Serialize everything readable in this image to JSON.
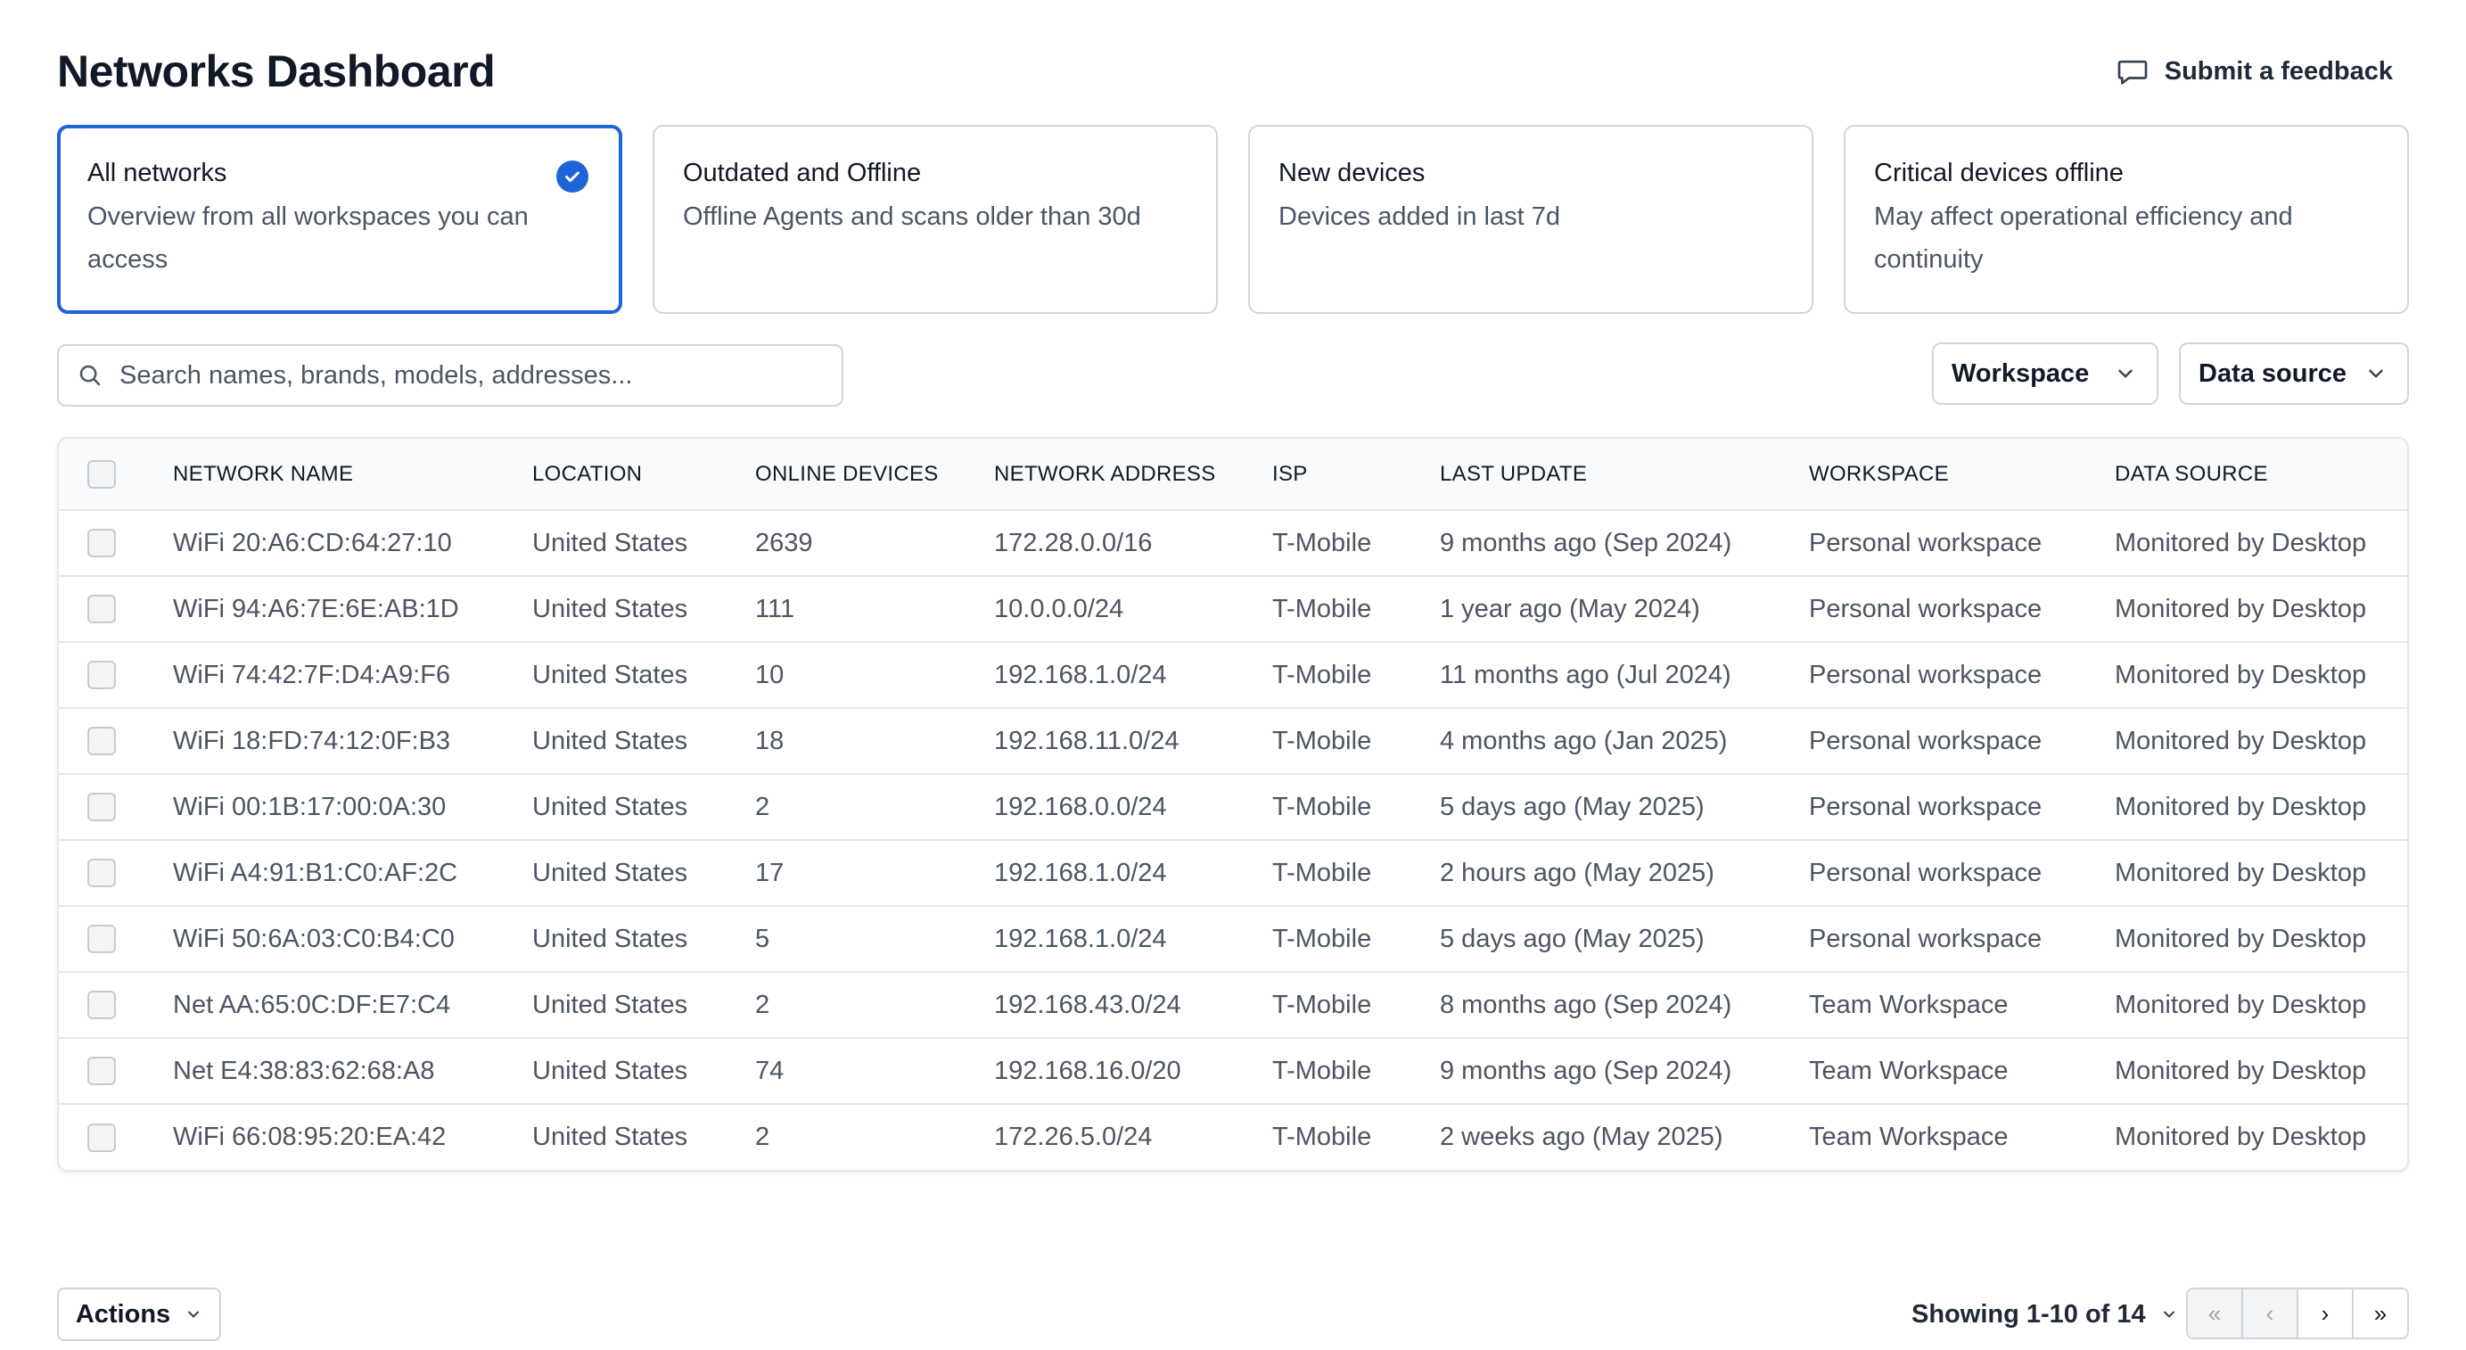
{
  "header": {
    "title": "Networks Dashboard",
    "feedback_label": "Submit a feedback"
  },
  "cards": [
    {
      "title": "All networks",
      "desc": "Overview from all workspaces you can access",
      "selected": true
    },
    {
      "title": "Outdated and Offline",
      "desc": "Offline Agents and scans older than 30d",
      "selected": false
    },
    {
      "title": "New devices",
      "desc": "Devices added in last 7d",
      "selected": false
    },
    {
      "title": "Critical devices offline",
      "desc": "May affect operational efficiency and continuity",
      "selected": false
    }
  ],
  "search": {
    "placeholder": "Search names, brands, models, addresses...",
    "value": ""
  },
  "filters": {
    "workspace_label": "Workspace",
    "data_source_label": "Data source"
  },
  "table": {
    "columns": [
      "NETWORK NAME",
      "LOCATION",
      "ONLINE DEVICES",
      "NETWORK ADDRESS",
      "ISP",
      "LAST UPDATE",
      "WORKSPACE",
      "DATA SOURCE"
    ],
    "rows": [
      [
        "WiFi 20:A6:CD:64:27:10",
        "United States",
        "2639",
        "172.28.0.0/16",
        "T-Mobile",
        "9 months ago (Sep 2024)",
        "Personal workspace",
        "Monitored by Desktop"
      ],
      [
        "WiFi 94:A6:7E:6E:AB:1D",
        "United States",
        "111",
        "10.0.0.0/24",
        "T-Mobile",
        "1 year ago (May 2024)",
        "Personal workspace",
        "Monitored by Desktop"
      ],
      [
        "WiFi 74:42:7F:D4:A9:F6",
        "United States",
        "10",
        "192.168.1.0/24",
        "T-Mobile",
        "11 months ago (Jul 2024)",
        "Personal workspace",
        "Monitored by Desktop"
      ],
      [
        "WiFi 18:FD:74:12:0F:B3",
        "United States",
        "18",
        "192.168.11.0/24",
        "T-Mobile",
        "4 months ago (Jan 2025)",
        "Personal workspace",
        "Monitored by Desktop"
      ],
      [
        "WiFi 00:1B:17:00:0A:30",
        "United States",
        "2",
        "192.168.0.0/24",
        "T-Mobile",
        "5 days ago (May 2025)",
        "Personal workspace",
        "Monitored by Desktop"
      ],
      [
        "WiFi A4:91:B1:C0:AF:2C",
        "United States",
        "17",
        "192.168.1.0/24",
        "T-Mobile",
        "2 hours ago (May 2025)",
        "Personal workspace",
        "Monitored by Desktop"
      ],
      [
        "WiFi 50:6A:03:C0:B4:C0",
        "United States",
        "5",
        "192.168.1.0/24",
        "T-Mobile",
        "5 days ago (May 2025)",
        "Personal workspace",
        "Monitored by Desktop"
      ],
      [
        "Net AA:65:0C:DF:E7:C4",
        "United States",
        "2",
        "192.168.43.0/24",
        "T-Mobile",
        "8 months ago (Sep 2024)",
        "Team Workspace",
        "Monitored by Desktop"
      ],
      [
        "Net E4:38:83:62:68:A8",
        "United States",
        "74",
        "192.168.16.0/20",
        "T-Mobile",
        "9 months ago (Sep 2024)",
        "Team Workspace",
        "Monitored by Desktop"
      ],
      [
        "WiFi 66:08:95:20:EA:42",
        "United States",
        "2",
        "172.26.5.0/24",
        "T-Mobile",
        "2 weeks ago (May 2025)",
        "Team Workspace",
        "Monitored by Desktop"
      ]
    ]
  },
  "footer": {
    "actions_label": "Actions",
    "showing_label": "Showing 1-10 of 14",
    "pager": {
      "first": "«",
      "prev": "‹",
      "next": "›",
      "last": "»"
    }
  },
  "colors": {
    "accent": "#1d64d8",
    "border": "#d1d5db",
    "muted_text": "#4b5563"
  },
  "icons": {
    "feedback": "chat-bubble-icon",
    "selected": "check-circle-icon",
    "search": "search-icon",
    "dropdown": "chevron-down-icon"
  }
}
